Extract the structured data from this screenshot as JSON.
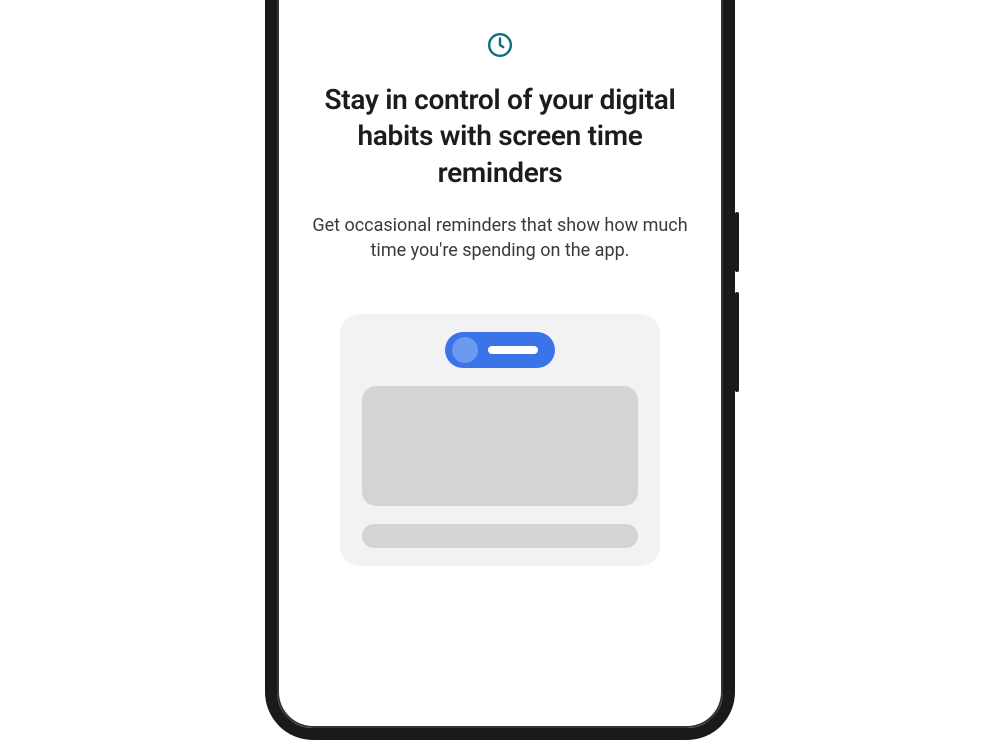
{
  "onboarding": {
    "icon": "clock-icon",
    "heading": "Stay in control of your digital habits with screen time reminders",
    "description": "Get occasional reminders that show how much time you're spending on the app."
  },
  "colors": {
    "iconColor": "#0d6e7a",
    "toggleBg": "#3b74e8",
    "illustrationBg": "#f2f2f4",
    "placeholderBg": "#d4d4d6"
  }
}
